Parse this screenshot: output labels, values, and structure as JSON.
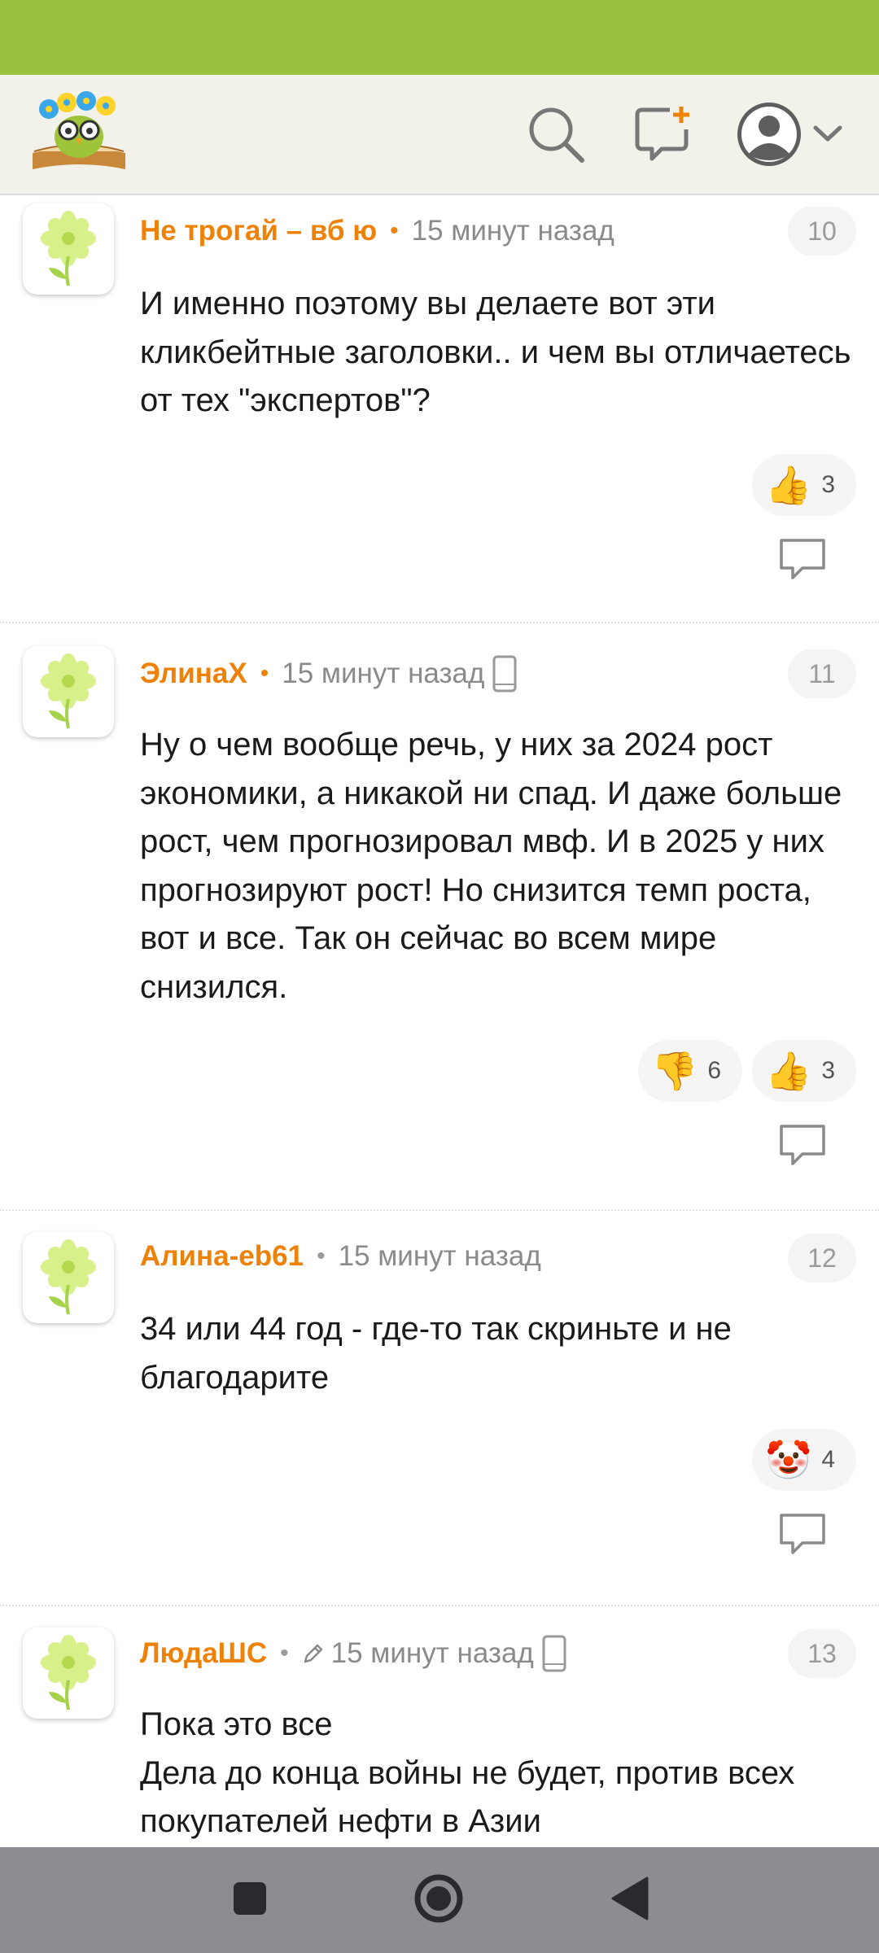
{
  "status_bar": {
    "color": "#9bc23f"
  },
  "header": {
    "logo": "owl-reading-book-logo",
    "search_icon": "search-icon",
    "new_post_icon": "new-message-plus-icon",
    "avatar_icon": "user-avatar-icon",
    "dropdown_icon": "chevron-down-icon"
  },
  "comments": [
    {
      "author": "Не трогай – вб ю",
      "time": "15 минут назад",
      "number": "10",
      "text": "И именно поэтому вы делаете вот эти кликбейтные заголовки.. и чем вы отличаетесь от тех \"экспертов\"?",
      "reactions": [
        {
          "icon": "thumbs-up",
          "emoji": "👍",
          "count": "3"
        }
      ]
    },
    {
      "author": "ЭлинаХ",
      "time": "15 минут назад",
      "number": "11",
      "text": "Ну о чем вообще речь, у них за 2024 рост экономики, а никакой ни спад. И даже больше рост, чем прогнозировал мвф. И в 2025 у них прогнозируют рост! Но снизится темп роста, вот и все. Так он сейчас во всем мире снизился.",
      "reactions": [
        {
          "icon": "thumbs-down",
          "emoji": "👎",
          "count": "6"
        },
        {
          "icon": "thumbs-up",
          "emoji": "👍",
          "count": "3"
        }
      ]
    },
    {
      "author": "Алина-eb61",
      "time": "15 минут назад",
      "number": "12",
      "text": "34 или 44 год - где-то так скриньте и не благодарите",
      "reactions": [
        {
          "icon": "clown-face",
          "emoji": "🤡",
          "count": "4"
        }
      ]
    },
    {
      "author": "ЛюдаШС",
      "time": "15 минут назад",
      "number": "13",
      "text": "Пока это все\nДела до конца войны не будет, против всех покупателей нефти в Азии",
      "reactions": []
    }
  ],
  "nav": {
    "recents_icon": "square-recents-icon",
    "home_icon": "circle-home-icon",
    "back_icon": "triangle-back-icon"
  },
  "colors": {
    "accent": "#ee8208",
    "header_bg": "#f3f2ea",
    "nav_bg": "#8c8d93"
  }
}
